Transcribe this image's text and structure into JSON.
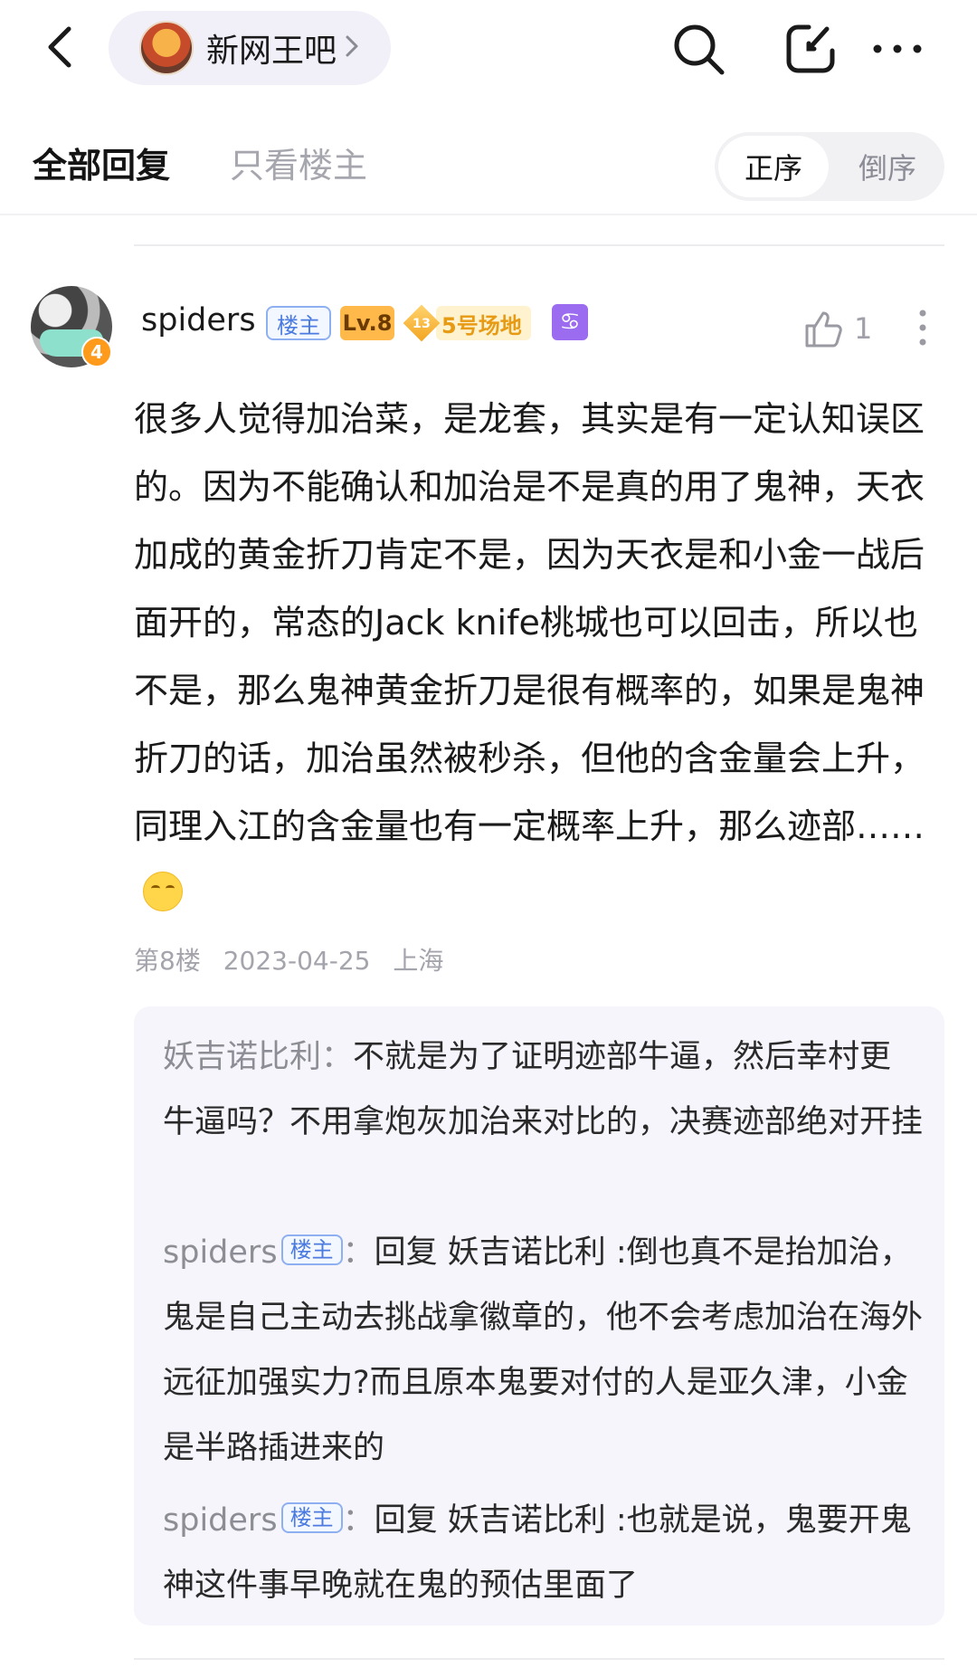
{
  "header": {
    "forum_name": "新网王吧"
  },
  "tabs": {
    "all_replies": "全部回复",
    "only_op": "只看楼主",
    "order_asc": "正序",
    "order_desc": "倒序"
  },
  "post": {
    "username": "spiders",
    "op_badge": "楼主",
    "level": "Lv.8",
    "club_level": "13",
    "club_name": "5号场地",
    "zodiac": "♋",
    "avatar_badge": "4",
    "like_count": "1",
    "content": "很多人觉得加治菜，是龙套，其实是有一定认知误区的。因为不能确认和加治是不是真的用了鬼神，天衣加成的黄金折刀肯定不是，因为天衣是和小金一战后面开的，常态的Jack knife桃城也可以回击，所以也不是，那么鬼神黄金折刀是很有概率的，如果是鬼神折刀的话，加治虽然被秒杀，但他的含金量会上升，同理入江的含金量也有一定概率上升，那么迹部……",
    "floor": "第8楼",
    "date": "2023-04-25",
    "location": "上海"
  },
  "replies": [
    {
      "name": "妖吉诺比利",
      "sep": "：",
      "text": "不就是为了证明迹部牛逼，然后幸村更牛逼吗？不用拿炮灰加治来对比的，决赛迹部绝对开挂"
    },
    {
      "name": "spiders",
      "tag": "楼主",
      "sep": "：",
      "reply_prefix": "回复 ",
      "reply_to": "妖吉诺比利",
      "text": " :倒也真不是抬加治，鬼是自己主动去挑战拿徽章的，他不会考虑加治在海外远征加强实力?而且原本鬼要对付的人是亚久津，小金是半路插进来的"
    },
    {
      "name": "spiders",
      "tag": "楼主",
      "sep": "：",
      "reply_prefix": "回复 ",
      "reply_to": "妖吉诺比利",
      "text": " :也就是说，鬼要开鬼神这件事早晚就在鬼的预估里面了"
    }
  ]
}
